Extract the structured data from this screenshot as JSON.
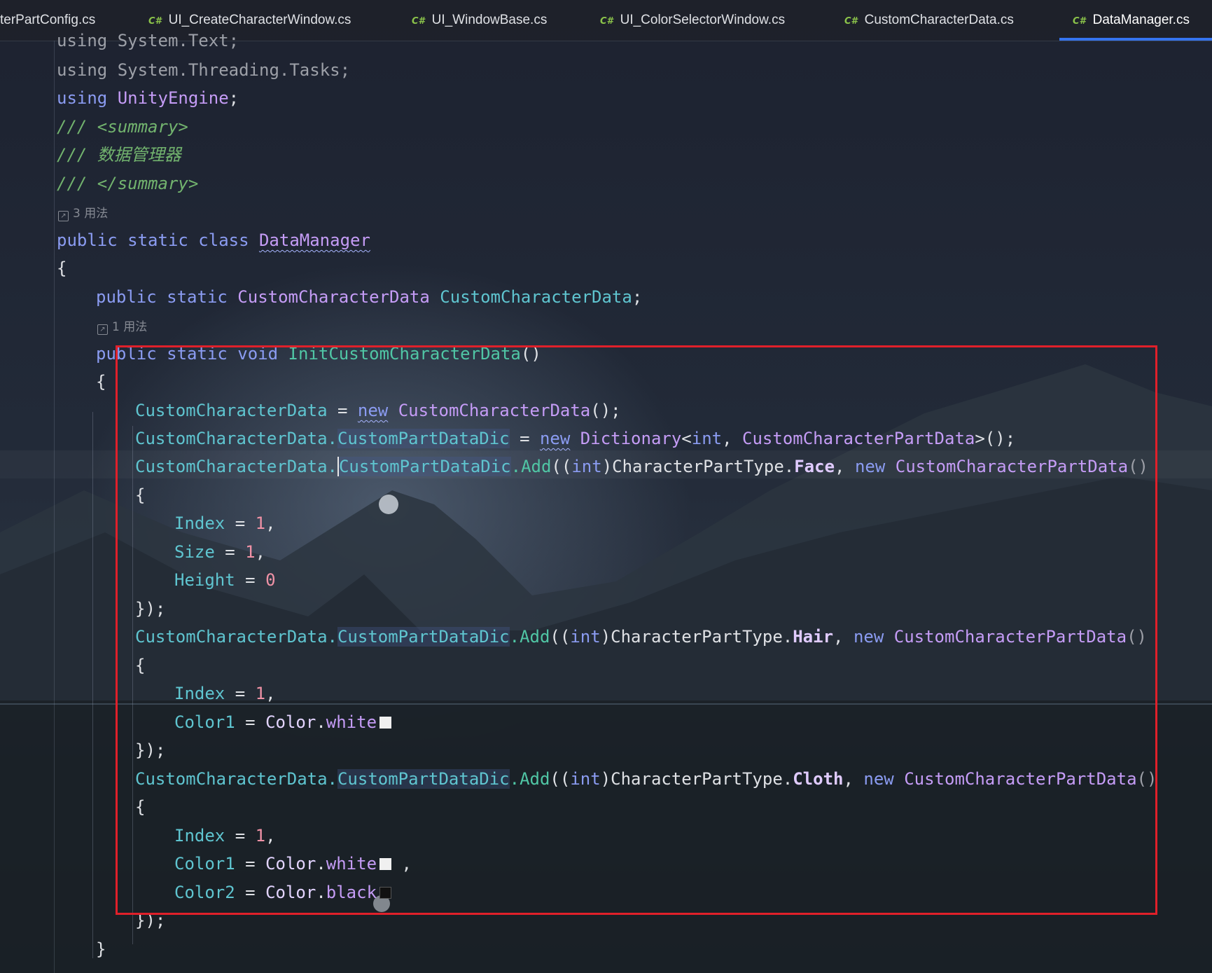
{
  "tabs": [
    {
      "lang": "",
      "label": "terPartConfig.cs",
      "active": false
    },
    {
      "lang": "C#",
      "label": "UI_CreateCharacterWindow.cs",
      "active": false
    },
    {
      "lang": "C#",
      "label": "UI_WindowBase.cs",
      "active": false
    },
    {
      "lang": "C#",
      "label": "UI_ColorSelectorWindow.cs",
      "active": false
    },
    {
      "lang": "C#",
      "label": "CustomCharacterData.cs",
      "active": false
    },
    {
      "lang": "C#",
      "label": "DataManager.cs",
      "active": true
    }
  ],
  "code": {
    "l0": "using System.Text;",
    "l1_kw": "using",
    "l1_ns": "System.Threading.Tasks;",
    "l2_kw": "using",
    "l2_ns": "UnityEngine",
    "l2_end": ";",
    "l3_slash": "/// ",
    "l3_tag": "<summary>",
    "l4_slash": "/// ",
    "l4_text": "数据管理器",
    "l5_slash": "/// ",
    "l5_tag": "</summary>",
    "hint_class": "3 用法",
    "l6_kw": "public static class ",
    "l6_cls": "DataManager",
    "brace_open": "{",
    "l8_kw": "public static ",
    "l8_type": "CustomCharacterData",
    "l8_name": " CustomCharacterData",
    "l8_end": ";",
    "hint_method": "1 用法",
    "l9_kw": "public static void ",
    "l9_fn": "InitCustomCharacterData",
    "l9_end": "()",
    "l11_a": "CustomCharacterData",
    "l11_b": " = ",
    "l11_new": "new",
    "l11_type": " CustomCharacterData",
    "l11_end": "();",
    "l12_a": "CustomCharacterData.",
    "l12_b": "CustomPartDataDic",
    "l12_c": " = ",
    "l12_new": "new",
    "l12_dict": " Dictionary",
    "l12_lt": "<",
    "l12_int": "int",
    "l12_comma": ", ",
    "l12_part": "CustomCharacterPartData",
    "l12_end": ">();",
    "add_obj": "CustomCharacterData.",
    "add_dic": "CustomPartDataDic",
    "add_call": ".Add",
    "add_paren": "((",
    "add_int": "int",
    "add_close": ")",
    "add_enum": "CharacterPartType.",
    "enum_face": "Face",
    "enum_hair": "Hair",
    "enum_cloth": "Cloth",
    "add_comma": ", ",
    "add_new": "new",
    "add_type": " CustomCharacterPartData",
    "add_ctor": "()",
    "prop_index": "Index",
    "prop_size": "Size",
    "prop_height": "Height",
    "prop_color1": "Color1",
    "prop_color2": "Color2",
    "eq": " = ",
    "one": "1",
    "zero": "0",
    "comma": ",",
    "color_cls": "Color",
    "dot": ".",
    "white": "white",
    "black": "black",
    "close_stmt": "});",
    "brace_close": "}"
  },
  "colors": {
    "highlight_box": "#e0202a",
    "active_tab_underline": "#3574f0"
  }
}
